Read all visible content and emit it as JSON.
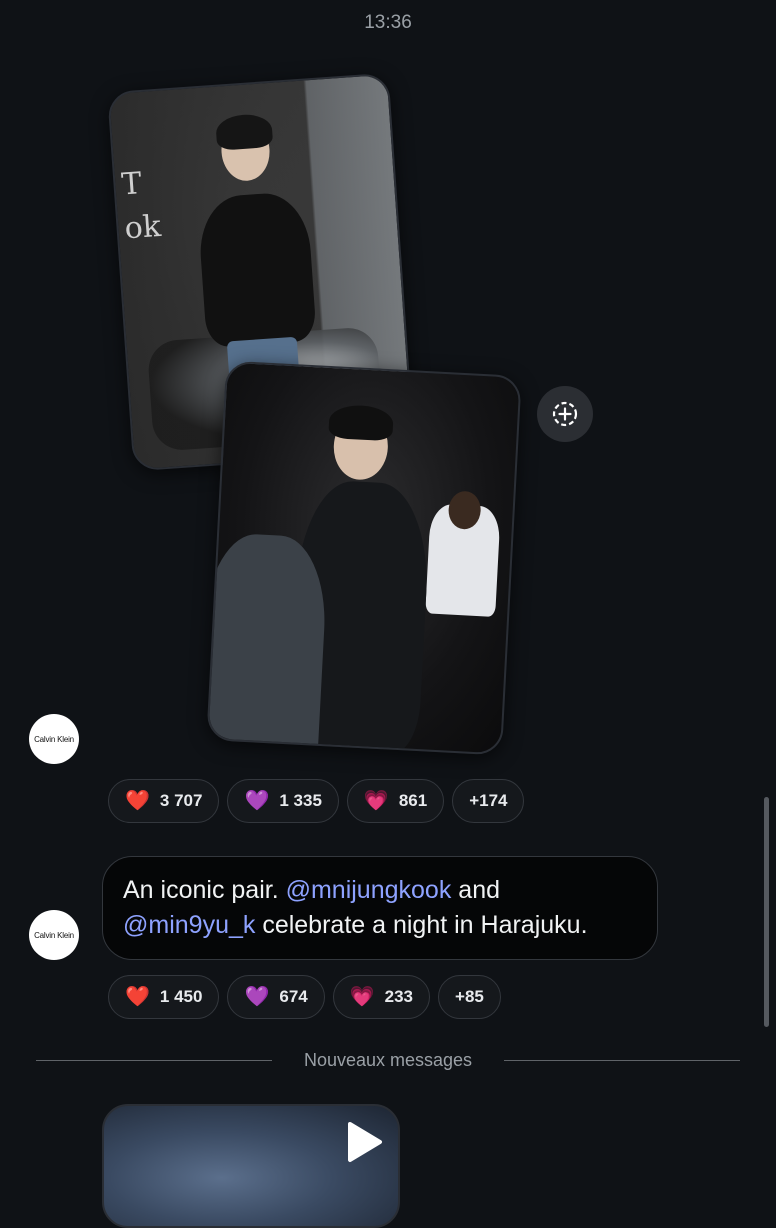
{
  "status": {
    "time": "13:36"
  },
  "post1": {
    "photo1_text": "T\nok",
    "author_logo": "Calvin Klein",
    "reactions": [
      {
        "emoji": "❤️",
        "count": "3 707"
      },
      {
        "emoji": "💜",
        "count": "1 335"
      },
      {
        "emoji": "💗",
        "count": "861"
      },
      {
        "emoji": "",
        "count": "+174"
      }
    ]
  },
  "post2": {
    "author_logo": "Calvin Klein",
    "message": {
      "part1": "An iconic pair. ",
      "mention1": "@mnijungkook",
      "part2": " and ",
      "mention2": "@min9yu_k",
      "part3": " celebrate a night in Harajuku."
    },
    "reactions": [
      {
        "emoji": "❤️",
        "count": "1 450"
      },
      {
        "emoji": "💜",
        "count": "674"
      },
      {
        "emoji": "💗",
        "count": "233"
      },
      {
        "emoji": "",
        "count": "+85"
      }
    ]
  },
  "divider": {
    "label": "Nouveaux messages"
  },
  "icons": {
    "add_reaction": "add-reaction-icon",
    "play": "play-icon"
  },
  "colors": {
    "background": "#0f1216",
    "mention": "#8ea2ff",
    "pill_border": "#33373d"
  }
}
